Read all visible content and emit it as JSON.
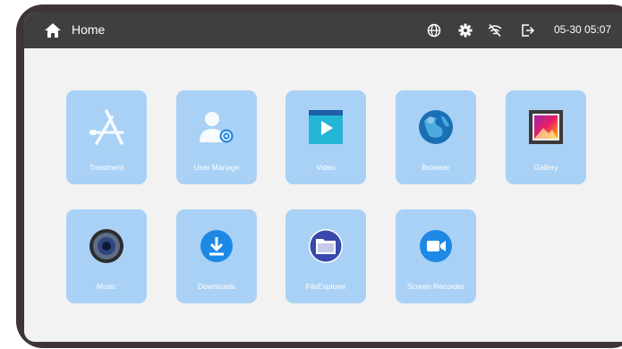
{
  "header": {
    "title": "Home",
    "clock": "05-30 05:07"
  },
  "status_icons": [
    "globe-icon",
    "gear-icon",
    "wifi-off-icon",
    "logout-icon"
  ],
  "apps": [
    {
      "label": "Treatment",
      "icon": "app-store-icon"
    },
    {
      "label": "User Manage",
      "icon": "user-settings-icon"
    },
    {
      "label": "Video",
      "icon": "video-play-icon"
    },
    {
      "label": "Browser",
      "icon": "globe-browser-icon"
    },
    {
      "label": "Gallery",
      "icon": "picture-icon"
    },
    {
      "label": "Music",
      "icon": "speaker-icon"
    },
    {
      "label": "Downloads",
      "icon": "download-icon"
    },
    {
      "label": "FileExplorer",
      "icon": "folder-icon"
    },
    {
      "label": "Screen Recorder",
      "icon": "camera-icon"
    }
  ],
  "colors": {
    "topbar": "#3f3f3f",
    "tile": "#a9d1f6",
    "screen": "#f2f2f2",
    "bezel": "#3d3536",
    "accent_blue": "#1e88e5"
  }
}
